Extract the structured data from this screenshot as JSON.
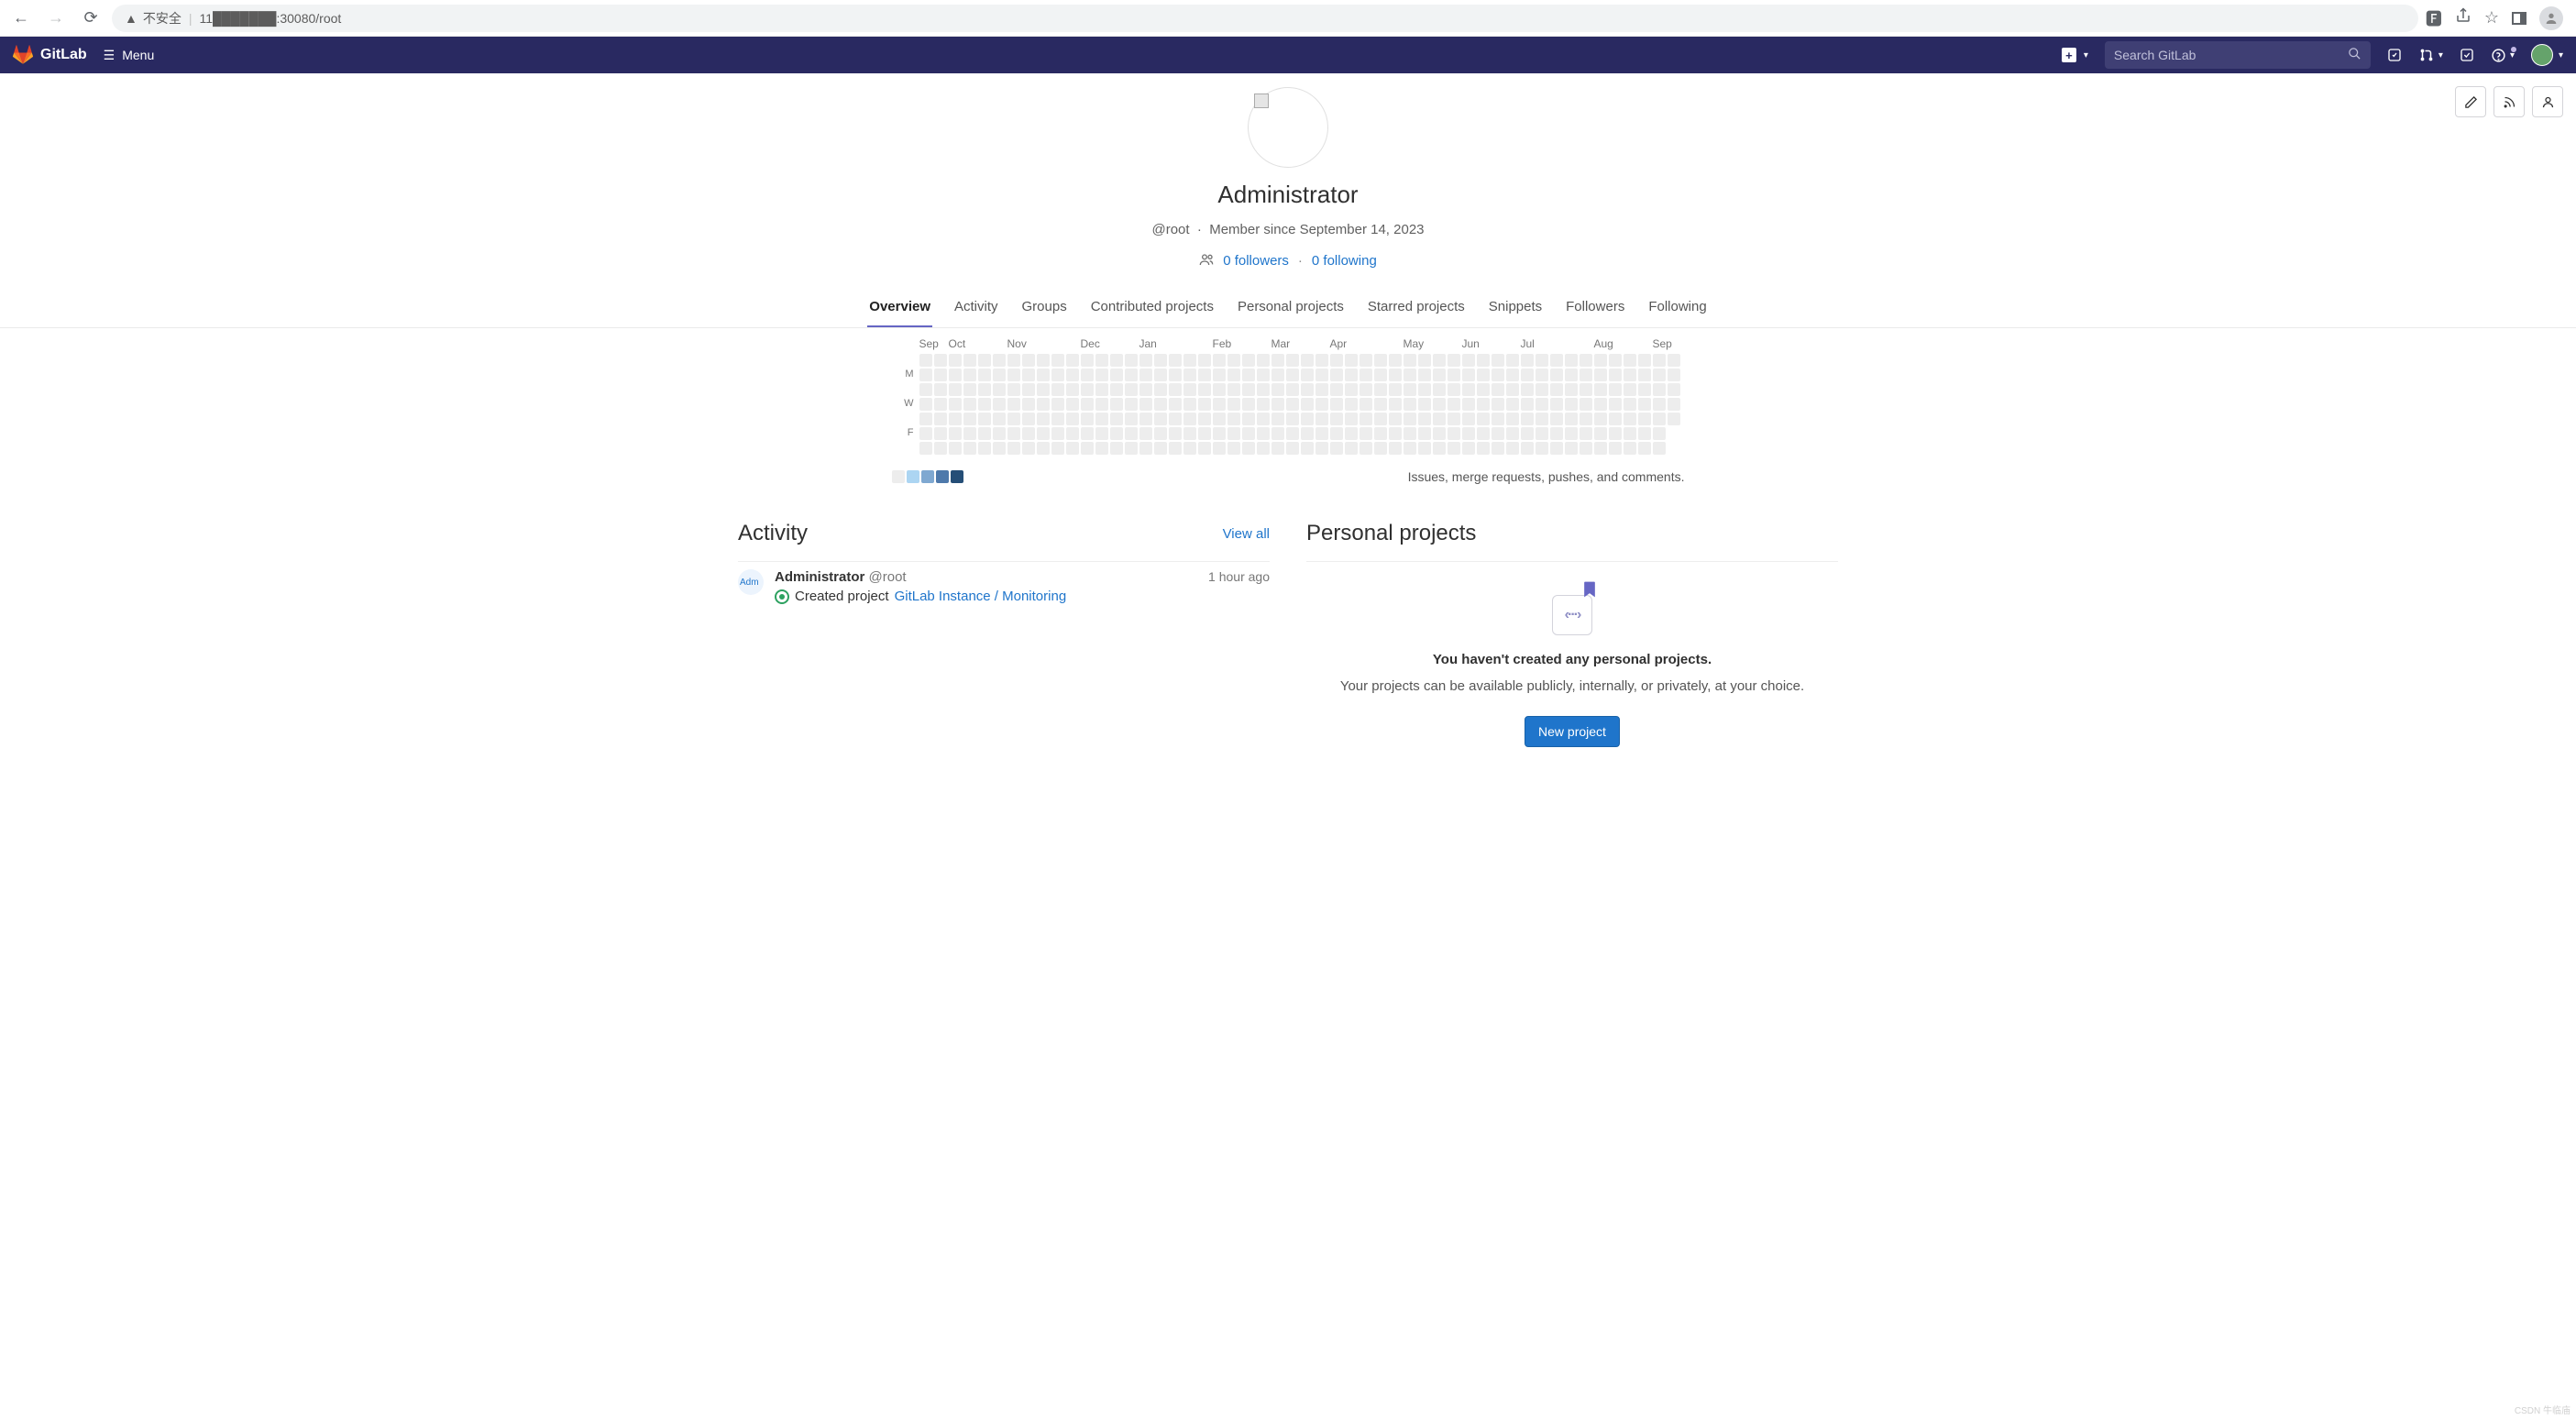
{
  "browser": {
    "url_insecure_label": "不安全",
    "url_text": "11███████:30080/root"
  },
  "header": {
    "brand": "GitLab",
    "menu_label": "Menu",
    "search_placeholder": "Search GitLab"
  },
  "profile": {
    "name": "Administrator",
    "handle": "@root",
    "member_since": "Member since September 14, 2023",
    "followers": "0 followers",
    "following": "0 following"
  },
  "tabs": [
    "Overview",
    "Activity",
    "Groups",
    "Contributed projects",
    "Personal projects",
    "Starred projects",
    "Snippets",
    "Followers",
    "Following"
  ],
  "calendar": {
    "months": [
      "Sep",
      "Oct",
      "Nov",
      "Dec",
      "Jan",
      "Feb",
      "Mar",
      "Apr",
      "May",
      "Jun",
      "Jul",
      "Aug",
      "Sep"
    ],
    "day_labels": [
      "",
      "M",
      "",
      "W",
      "",
      "F",
      ""
    ],
    "note": "Issues, merge requests, pushes, and comments.",
    "legend_colors": [
      "#ededed",
      "#acd5f2",
      "#7fa8d1",
      "#4e79ab",
      "#254e77"
    ]
  },
  "activity": {
    "title": "Activity",
    "view_all": "View all",
    "item": {
      "name": "Administrator",
      "handle": "@root",
      "time": "1 hour ago",
      "action": "Created project",
      "project": "GitLab Instance / Monitoring"
    }
  },
  "personal": {
    "title": "Personal projects",
    "empty_heading": "You haven't created any personal projects.",
    "empty_text": "Your projects can be available publicly, internally, or privately, at your choice.",
    "button": "New project"
  },
  "watermark": "CSDN 牛临庙"
}
